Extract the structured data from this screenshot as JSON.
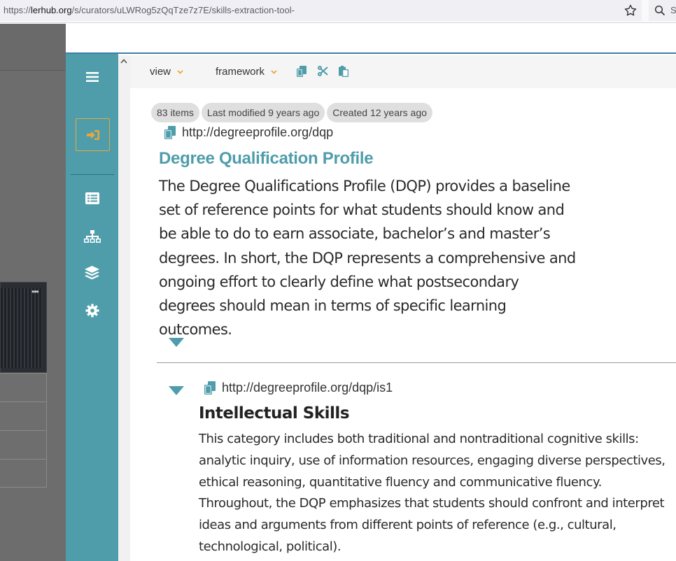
{
  "browser": {
    "url_prefix": "https://",
    "url_host": "lerhub.org",
    "url_path": "/s/curators/uLWRog5zQqTze7z7E/skills-extraction-tool-",
    "search_label": "S"
  },
  "sidebar": {
    "menu_icon": "hamburger-icon",
    "login_icon": "sign-in-icon",
    "items": [
      "list-icon",
      "sitemap-icon",
      "layers-icon",
      "gear-icon"
    ],
    "accent": "#e8a73c",
    "bg": "#4f9dab"
  },
  "toolbar": {
    "view_label": "view",
    "framework_label": "framework",
    "icons": [
      "copy-icon",
      "cut-icon",
      "paste-icon"
    ]
  },
  "framework": {
    "badges": [
      "83 items",
      "Last modified 9 years ago",
      "Created 12 years ago"
    ],
    "uri": "http://degreeprofile.org/dqp",
    "title": "Degree Qualification Profile",
    "description": "The Degree Qualifications Profile (DQP) provides a baseline set of reference points for what students should know and be able to do to earn associate, bachelor’s and master’s degrees. In short, the DQP represents a comprehensive and ongoing effort to clearly define what postsecondary degrees should mean in terms of specific learning outcomes."
  },
  "competency": {
    "uri": "http://degreeprofile.org/dqp/is1",
    "title": "Intellectual Skills",
    "description": "This category includes both traditional and nontraditional cognitive skills: analytic inquiry, use of information resources, engaging diverse perspectives, ethical reasoning, quantitative fluency and communicative fluency. Throughout, the DQP emphasizes that students should confront and interpret ideas and arguments from different points of reference (e.g., cultural, technological, political)."
  }
}
